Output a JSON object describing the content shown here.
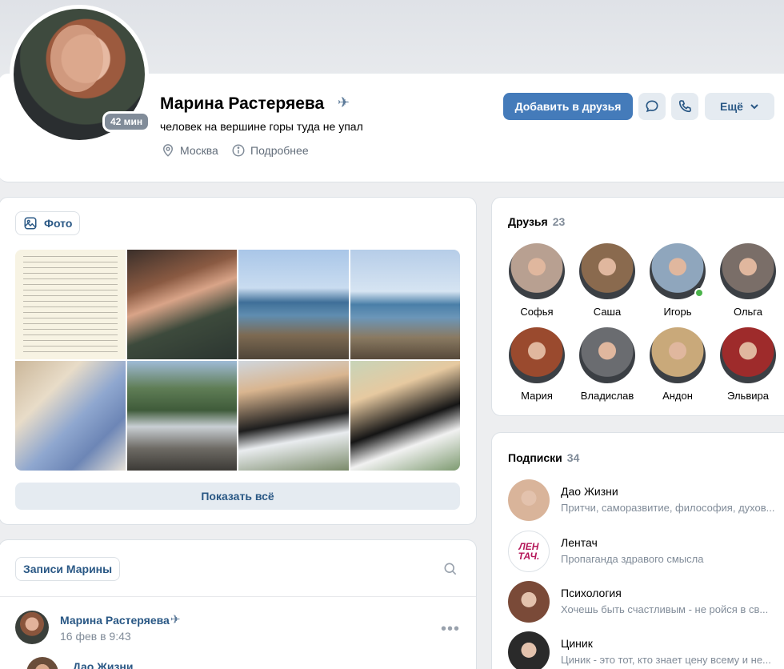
{
  "profile": {
    "name": "Марина Растеряева",
    "online": "42 мин",
    "status": "человек на вершине горы туда не упал",
    "city": "Москва",
    "details": "Подробнее",
    "add_friend": "Добавить в друзья",
    "more": "Ещё"
  },
  "photos": {
    "chip": "Фото",
    "show_all": "Показать всё"
  },
  "posts": {
    "chip": "Записи Марины",
    "author": "Марина Растеряева",
    "date": "16 фев в 9:43",
    "repost_name": "Дао Жизни"
  },
  "friends": {
    "title": "Друзья",
    "count": "23",
    "items": [
      {
        "name": "Софья",
        "color": "#b8a091"
      },
      {
        "name": "Саша",
        "color": "#8a6a4e"
      },
      {
        "name": "Игорь",
        "color": "#8fa6bd",
        "online": true
      },
      {
        "name": "Ольга",
        "color": "#7a6e68"
      },
      {
        "name": "Мария",
        "color": "#9a4a2e"
      },
      {
        "name": "Владислав",
        "color": "#6a6c70"
      },
      {
        "name": "Андон",
        "color": "#c9a97a"
      },
      {
        "name": "Эльвира",
        "color": "#9e2b2b"
      }
    ]
  },
  "subscriptions": {
    "title": "Подписки",
    "count": "34",
    "items": [
      {
        "name": "Дао Жизни",
        "desc": "Притчи, саморазвитие, философия, духов...",
        "color": "#d9b49a"
      },
      {
        "name": "Лентач",
        "desc": "Пропаганда здравого смысла",
        "color": "#ffffff",
        "logo": "ЛЕН\nТАЧ."
      },
      {
        "name": "Психология",
        "desc": "Хочешь быть счастливым - не ройся в св...",
        "color": "#7a4a38"
      },
      {
        "name": "Циник",
        "desc": "Циник - это тот, кто знает цену всему и не...",
        "color": "#2a2a2a"
      }
    ]
  }
}
